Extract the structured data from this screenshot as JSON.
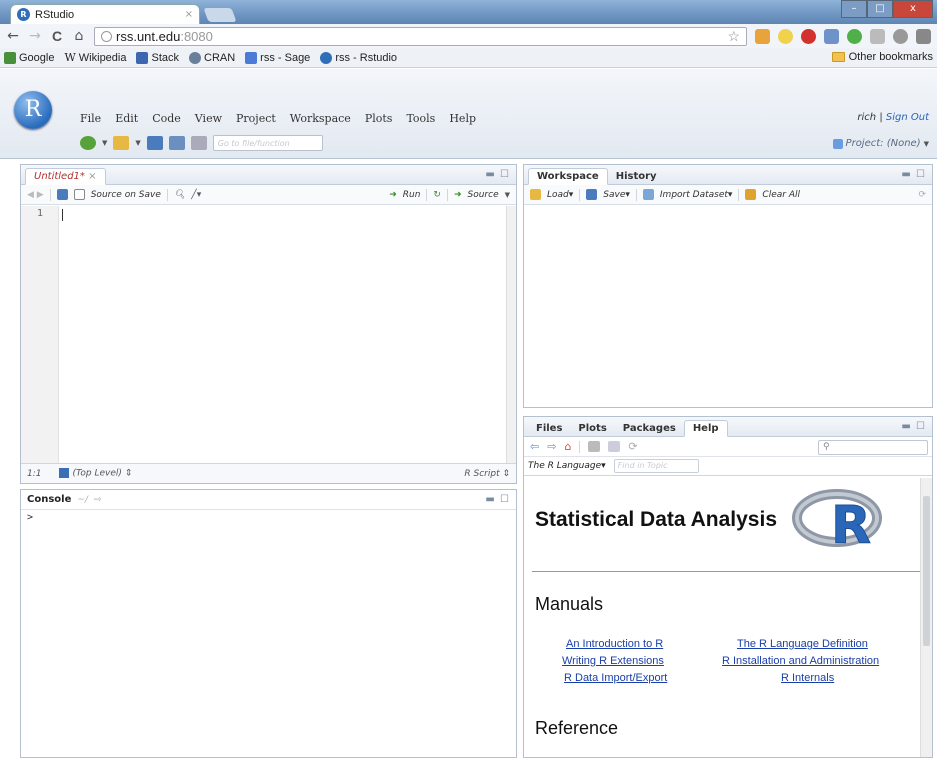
{
  "browser": {
    "tab_title": "RStudio",
    "tab_close": "×",
    "url_host": "rss.unt.edu",
    "url_port": ":8080",
    "window_controls": [
      "–",
      "□",
      "x"
    ],
    "nav": {
      "back": "←",
      "forward": "→",
      "reload": "C",
      "home": "⌂"
    },
    "bookmarks": [
      {
        "label": "Google",
        "color": "#4a8f3a"
      },
      {
        "label": "Wikipedia",
        "color": "#777777"
      },
      {
        "label": "Stack",
        "color": "#3d66b0"
      },
      {
        "label": "CRAN",
        "color": "#6a7f9a"
      },
      {
        "label": "rss - Sage",
        "color": "#4b7bd6"
      },
      {
        "label": "rss - Rstudio",
        "color": "#2f6fb7"
      }
    ],
    "other_bookmarks": "Other bookmarks"
  },
  "rstudio": {
    "logo_letter": "R",
    "menu": [
      "File",
      "Edit",
      "Code",
      "View",
      "Project",
      "Workspace",
      "Plots",
      "Tools",
      "Help"
    ],
    "goto_placeholder": "Go to file/function",
    "user": "rich",
    "sign_out": "Sign Out",
    "project": "Project: (None)"
  },
  "editor": {
    "tab": "Untitled1*",
    "source_on_save": "Source on Save",
    "run": "Run",
    "source": "Source",
    "line_number": "1",
    "position": "1:1",
    "scope": "(Top Level)",
    "file_type": "R Script"
  },
  "console": {
    "title": "Console",
    "path": "~/",
    "prompt": ">"
  },
  "workspace": {
    "tabs": [
      "Workspace",
      "History"
    ],
    "load": "Load",
    "save": "Save",
    "import": "Import Dataset",
    "clear": "Clear All"
  },
  "help": {
    "tabs": [
      "Files",
      "Plots",
      "Packages",
      "Help"
    ],
    "topic": "The R Language",
    "find_placeholder": "Find in Topic",
    "title": "Statistical Data Analysis",
    "manuals_heading": "Manuals",
    "links_left": [
      "An Introduction to R",
      "Writing R Extensions",
      "R Data Import/Export"
    ],
    "links_right": [
      "The R Language Definition",
      "R Installation and Administration",
      "R Internals"
    ],
    "reference_heading": "Reference"
  },
  "colors": {
    "accent": "#2a6cbc",
    "link": "#1a3fa8",
    "modified_tab": "#b03030"
  }
}
